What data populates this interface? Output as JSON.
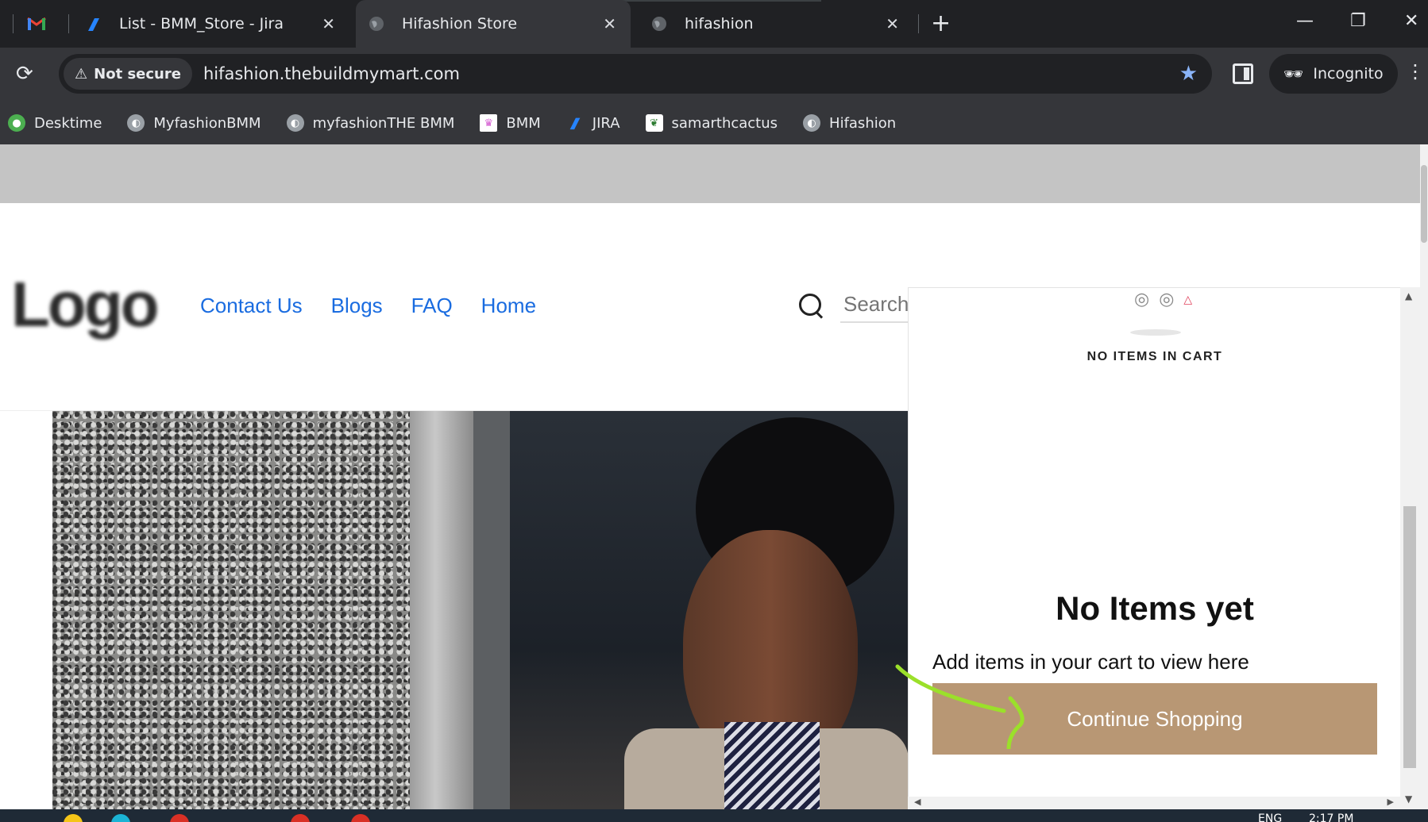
{
  "browser": {
    "tabs": [
      {
        "title": "List - BMM_Store - Jira",
        "active": false
      },
      {
        "title": "Hifashion Store",
        "active": true
      },
      {
        "title": "hifashion",
        "active": false
      }
    ],
    "security_label": "Not secure",
    "url": "hifashion.thebuildmymart.com",
    "incognito_label": "Incognito",
    "bookmarks": [
      {
        "label": "Desktime",
        "icon": "desktime-icon",
        "color": "#4caf50"
      },
      {
        "label": "MyfashionBMM",
        "icon": "globe-icon",
        "color": "#9aa0a6"
      },
      {
        "label": "myfashionTHE BMM",
        "icon": "globe-icon",
        "color": "#9aa0a6"
      },
      {
        "label": "BMM",
        "icon": "bmm-icon",
        "color": "#d45bd1"
      },
      {
        "label": "JIRA",
        "icon": "jira-icon",
        "color": "#2684ff"
      },
      {
        "label": "samarthcactus",
        "icon": "cactus-icon",
        "color": "#2e7d32"
      },
      {
        "label": "Hifashion",
        "icon": "globe-icon",
        "color": "#9aa0a6"
      }
    ]
  },
  "site": {
    "logo_text": "Logo",
    "nav": [
      "Contact Us",
      "Blogs",
      "FAQ",
      "Home"
    ],
    "search_placeholder": "Search"
  },
  "cart": {
    "caption": "NO ITEMS IN CART",
    "empty_title": "No Items yet",
    "empty_subtitle": "Add items in your cart to view here",
    "continue_label": "Continue Shopping",
    "button_color": "#b89774"
  },
  "taskbar": {
    "lang": "ENG",
    "time": "2:17 PM"
  },
  "colors": {
    "nav_link": "#1a6ce0",
    "annotation": "#9be02a"
  }
}
